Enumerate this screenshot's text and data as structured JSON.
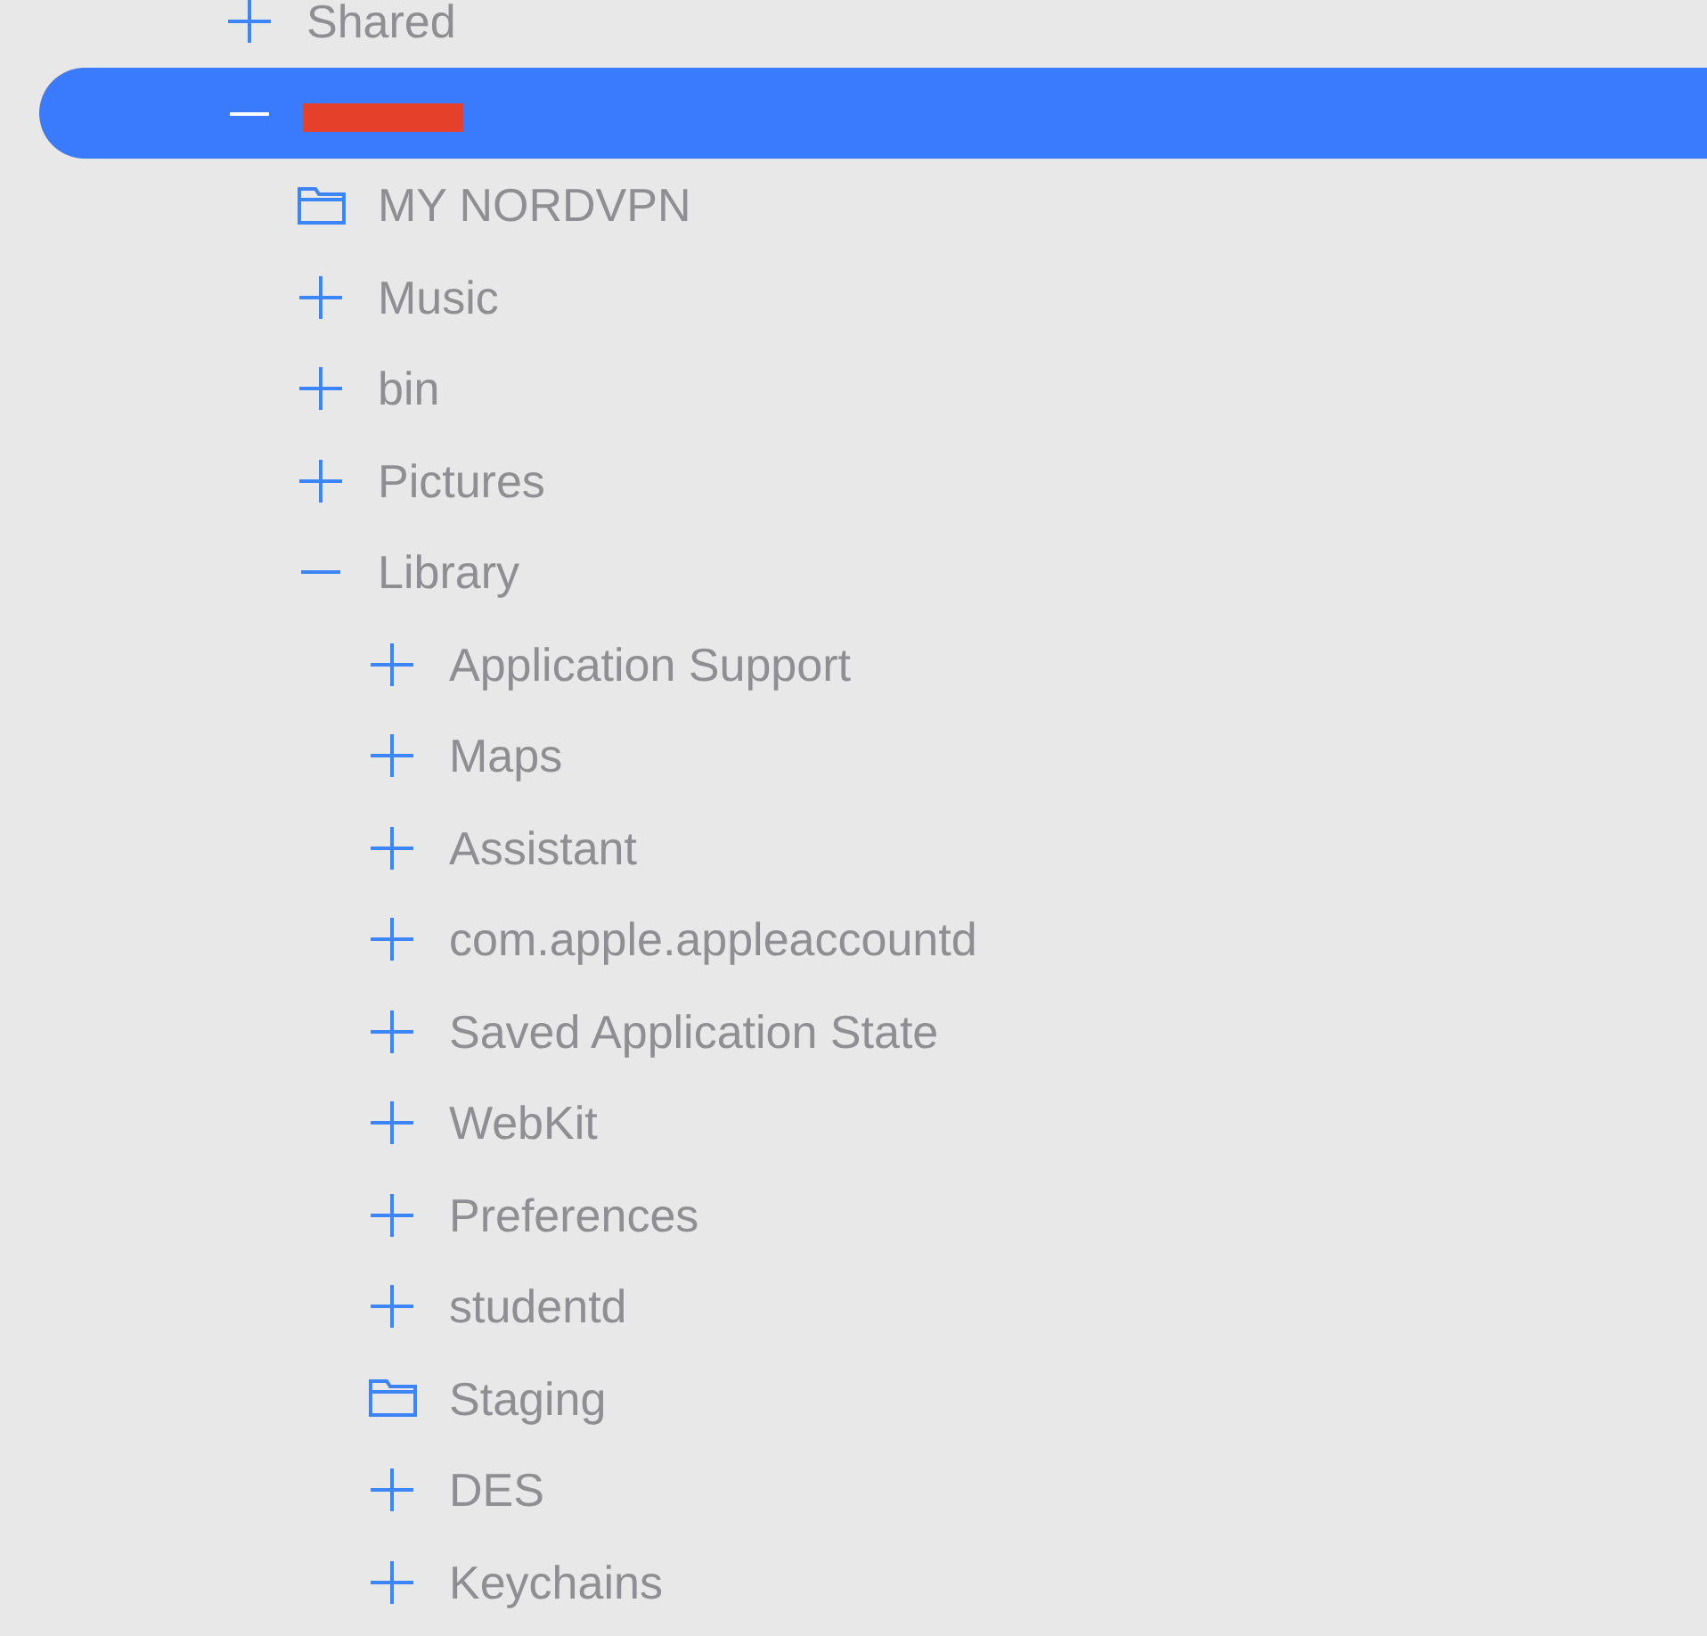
{
  "tree": [
    {
      "label": "Shared",
      "kind": "group",
      "expanded": false,
      "selected": false
    },
    {
      "redacted": true,
      "kind": "group",
      "expanded": true,
      "selected": true,
      "children": [
        {
          "label": "MY NORDVPN",
          "kind": "folder",
          "selected": false
        },
        {
          "label": "Music",
          "kind": "group",
          "expanded": false,
          "selected": false
        },
        {
          "label": "bin",
          "kind": "group",
          "expanded": false,
          "selected": false
        },
        {
          "label": "Pictures",
          "kind": "group",
          "expanded": false,
          "selected": false
        },
        {
          "label": "Library",
          "kind": "group",
          "expanded": true,
          "selected": false,
          "children": [
            {
              "label": "Application Support",
              "kind": "group",
              "expanded": false,
              "selected": false
            },
            {
              "label": "Maps",
              "kind": "group",
              "expanded": false,
              "selected": false
            },
            {
              "label": "Assistant",
              "kind": "group",
              "expanded": false,
              "selected": false
            },
            {
              "label": "com.apple.appleaccountd",
              "kind": "group",
              "expanded": false,
              "selected": false
            },
            {
              "label": "Saved Application State",
              "kind": "group",
              "expanded": false,
              "selected": false
            },
            {
              "label": "WebKit",
              "kind": "group",
              "expanded": false,
              "selected": false
            },
            {
              "label": "Preferences",
              "kind": "group",
              "expanded": false,
              "selected": false
            },
            {
              "label": "studentd",
              "kind": "group",
              "expanded": false,
              "selected": false
            },
            {
              "label": "Staging",
              "kind": "folder",
              "selected": false
            },
            {
              "label": "DES",
              "kind": "group",
              "expanded": false,
              "selected": false
            },
            {
              "label": "Keychains",
              "kind": "group",
              "expanded": false,
              "selected": false
            }
          ]
        }
      ]
    }
  ]
}
